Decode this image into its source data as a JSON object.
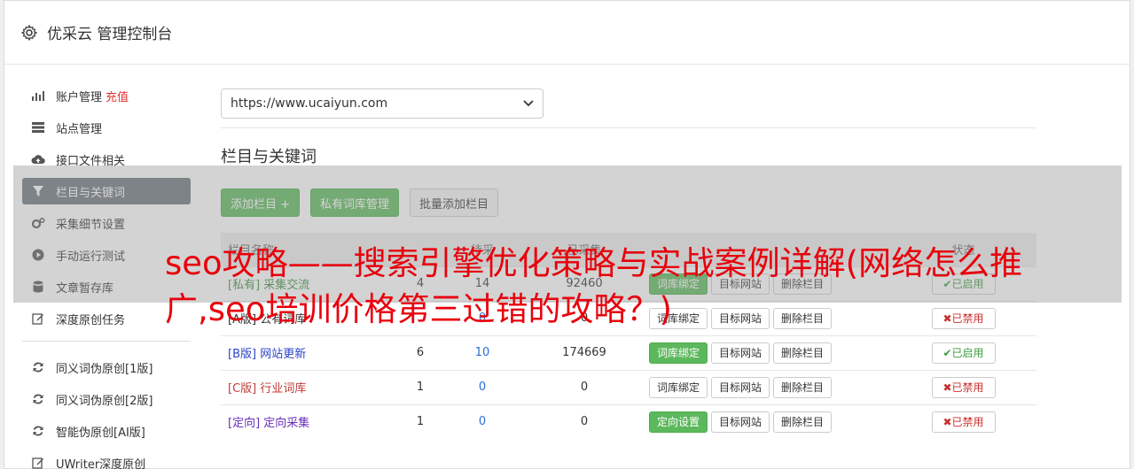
{
  "header": {
    "title": "优采云 管理控制台",
    "icon": "gear-icon"
  },
  "sidebar": {
    "items": [
      {
        "label": "账户管理",
        "extra": "充值",
        "icon": "bar-chart-icon"
      },
      {
        "label": "站点管理",
        "icon": "server-icon"
      },
      {
        "label": "接口文件相关",
        "icon": "cloud-upload-icon"
      },
      {
        "label": "栏目与关键词",
        "icon": "filter-icon",
        "active": true
      },
      {
        "label": "采集细节设置",
        "icon": "cogs-icon"
      },
      {
        "label": "手动运行测试",
        "icon": "play-icon"
      },
      {
        "label": "文章暂存库",
        "icon": "database-icon"
      },
      {
        "label": "深度原创任务",
        "icon": "edit-icon"
      }
    ],
    "items2": [
      {
        "label": "同义词伪原创[1版]",
        "icon": "refresh-icon"
      },
      {
        "label": "同义词伪原创[2版]",
        "icon": "refresh-icon"
      },
      {
        "label": "智能伪原创[AI版]",
        "icon": "refresh-icon"
      },
      {
        "label": "UWriter深度原创",
        "icon": "edit-icon"
      }
    ]
  },
  "main": {
    "site_select": "https://www.ucaiyun.com",
    "section_title": "栏目与关键词",
    "toolbar": {
      "add_column": "添加栏目 +",
      "private_lib": "私有词库管理",
      "batch_add": "批量添加栏目"
    },
    "table": {
      "headers": [
        "栏目名称",
        "",
        "待采",
        "已采集",
        "",
        "状态"
      ],
      "rows": [
        {
          "tag": "[私有]",
          "name": "采集交流",
          "c1": "4",
          "c2": "14",
          "c3": "92460",
          "btn1": "词库绑定",
          "btn1_green": true,
          "btn2": "目标网站",
          "btn3": "删除栏目",
          "status": "已启用",
          "status_on": true
        },
        {
          "tag": "[A版]",
          "name": "公有词库",
          "c1": "",
          "c2": "0",
          "c3": "0",
          "btn1": "词库绑定",
          "btn1_green": false,
          "btn2": "目标网站",
          "btn3": "删除栏目",
          "status": "已禁用",
          "status_on": false
        },
        {
          "tag": "[B版]",
          "name": "网站更新",
          "c1": "6",
          "c2": "10",
          "c3": "174669",
          "btn1": "词库绑定",
          "btn1_green": true,
          "btn2": "目标网站",
          "btn3": "删除栏目",
          "status": "已启用",
          "status_on": true
        },
        {
          "tag": "[C版]",
          "name": "行业词库",
          "c1": "1",
          "c2": "0",
          "c3": "0",
          "btn1": "词库绑定",
          "btn1_green": false,
          "btn2": "目标网站",
          "btn3": "删除栏目",
          "status": "已禁用",
          "status_on": false
        },
        {
          "tag": "[定向]",
          "name": "定向采集",
          "c1": "1",
          "c2": "0",
          "c3": "0",
          "btn1": "定向设置",
          "btn1_green": true,
          "btn2": "目标网站",
          "btn3": "删除栏目",
          "status": "已禁用",
          "status_on": false
        }
      ]
    }
  },
  "overlay_headline": "seo攻略——搜索引擎优化策略与实战案例详解(网络怎么推广,seo培训价格第三过错的攻略？)",
  "colors": {
    "accent_green": "#5cb85c",
    "headline_red": "#e8000b",
    "active_nav": "#6c757d"
  }
}
